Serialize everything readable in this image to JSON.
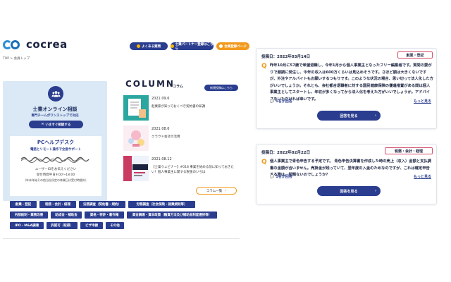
{
  "logo": {
    "text": "cocrea"
  },
  "breadcrumb": "TOP > 会員トップ",
  "header_buttons": [
    {
      "label": "よくある質問"
    },
    {
      "label": "士業パートナー登録はこちら"
    },
    {
      "label": "会員登録ページ"
    }
  ],
  "consult": {
    "title": "士業オンライン相談",
    "subtitle": "専門チームがワンストップで対応",
    "button": "いますぐ相談する",
    "pc": {
      "title": "PCヘルプデスク",
      "line1": "電話とリモート操作で全面サポート",
      "line2": "ユーザーIDをお伝えください",
      "line3": "受付時間平日9:00～18:00",
      "line4": "(年末年始その他当社所定の休業日は受付時間外)"
    }
  },
  "column": {
    "title": "COLUMN",
    "subtitle": "コラム",
    "register_button": "新規投稿はこちら",
    "items": [
      {
        "date": "2021.09.6",
        "text": "起業家が知っておくべき契約書の知識"
      },
      {
        "date": "2021.08.6",
        "text": "クラウド会計の活用"
      },
      {
        "date": "2021.08.12",
        "text": "【士業ウェビナー】#018 事業を始める前に知っておきたい！個人事業主に関する税金のいろは"
      }
    ],
    "more": "コラム一覧"
  },
  "tags": [
    "創業・登記",
    "税務・会計・経理",
    "法務調査（契約書・規約）",
    "労務調査（社会保険・就業規則等）",
    "内部統制・業務改善",
    "助成金・補助金",
    "資格・特許・著作権",
    "資金調達・資本政策（融資方法及び補助金制度選択等）",
    "IPO・M&A調達",
    "許認可（取得）",
    "ビザ申請",
    "その他"
  ],
  "questions": [
    {
      "date": "投稿日：2022年03月14日",
      "category": "創業・登記",
      "text": "昨年10月に57歳で希望退職し、今年1月から個人事業主となったフリー編集者です。質問の要がりで順調に受注し、今年の収入は600万くらいは見込めそうです。さほど額は大きくないですが、外注やアルバイトもお願いするつもりです。このような状況の場合、思い切って法人化した方がいいでしょうか。それとも、会社都合退職者に対する国民健康保険の優遇措置がある間は個人事業主としてスタートし、年収が多くなってから法人化を考えた方がいいでしょうか。アドバイスをいただければ幸いです。",
      "answers": "1名が回答",
      "more": "もっと見る",
      "button": "回答を見る"
    },
    {
      "date": "投稿日：2022年02月22日",
      "category": "税務・会計・経理",
      "text": "個人事業主で青色申告する予定です。 青色申告決算書を作成した時の売上（収入）金額と支払調書の金額が合いません。売掛金が残っていて、翌年度の入金のためなのですが、これは確定申告する際は、問題ないのでしょうか？",
      "answers": "1名が回答",
      "more": "もっと見る",
      "button": "回答を見る"
    }
  ],
  "colors": {
    "navy": "#2a3d8f",
    "orange": "#f29a1d",
    "pink": "#d44d6c",
    "light_blue": "#dbe9f6"
  }
}
